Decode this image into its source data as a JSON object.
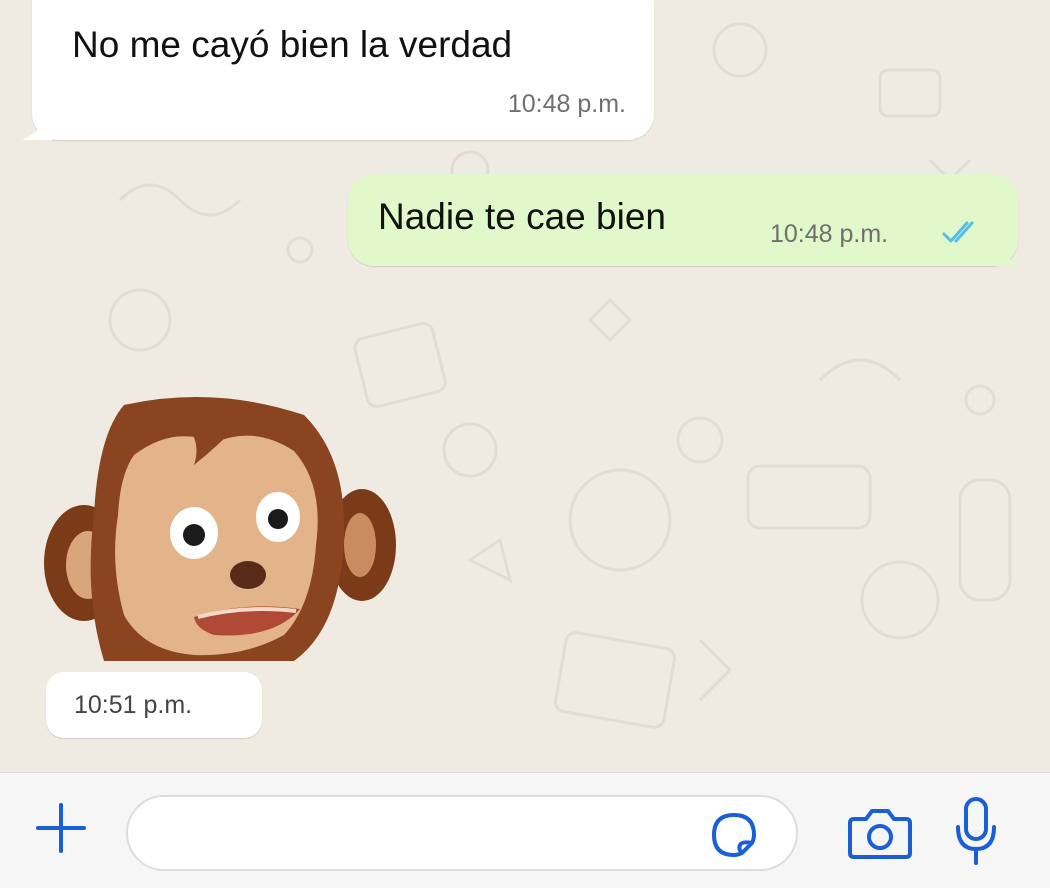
{
  "messages": [
    {
      "direction": "incoming",
      "text": "No me cayó bien la verdad",
      "time": "10:48 p.m."
    },
    {
      "direction": "outgoing",
      "text": "Nadie te cae bien",
      "time": "10:48 p.m.",
      "status": "read-double-check"
    }
  ],
  "sticker": {
    "kind": "surprised-monkey-puppet-sticker",
    "time": "10:51 p.m."
  },
  "input_bar": {
    "placeholder": "",
    "icons": {
      "attach": "plus-icon",
      "sticker": "sticker-icon",
      "camera": "camera-icon",
      "voice": "microphone-icon"
    }
  },
  "colors": {
    "wallpaper": "#efeae2",
    "incoming_bubble": "#ffffff",
    "outgoing_bubble": "#e1f8cb",
    "accent_blue": "#1a5fd6",
    "read_tick": "#53bdeb",
    "timestamp": "#6f6f6f"
  }
}
